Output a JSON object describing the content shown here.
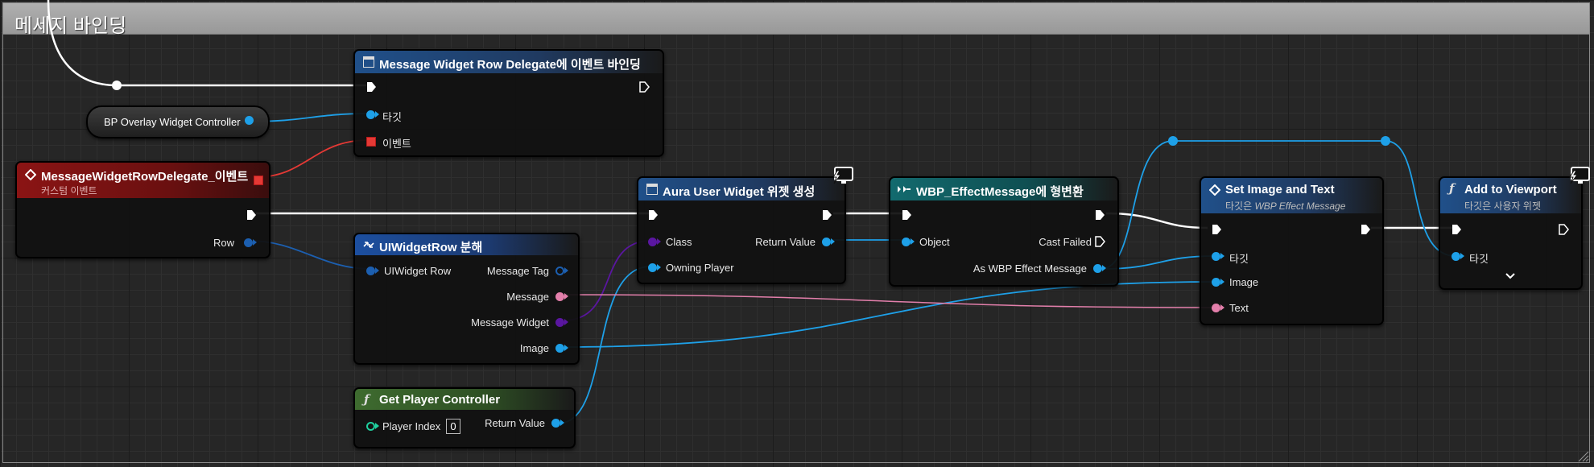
{
  "comment": {
    "title": "메세지 바인딩"
  },
  "colors": {
    "exec": "#ffffff",
    "object": "#1ea0e8",
    "class": "#5a16a0",
    "struct": "#1c5fb0",
    "string": "#e37fab",
    "text": "#e37fab",
    "event": "#e53935",
    "int": "#1fcf9e",
    "header_event": "#8b1414",
    "header_function": "#20508a",
    "header_pure": "#3e6b2f",
    "header_cast": "#126a6e"
  },
  "nodes": {
    "bind_event": {
      "title": "Message Widget Row Delegate에 이벤트 바인딩",
      "target_label": "타깃",
      "event_label": "이벤트",
      "icon": "function-square-icon"
    },
    "bp_overlay": {
      "label": "BP Overlay Widget Controller"
    },
    "custom_event": {
      "title": "MessageWidgetRowDelegate_이벤트",
      "subtitle": "커스텀 이벤트",
      "row_label": "Row",
      "icon": "event-diamond-icon"
    },
    "break_row": {
      "title": "UIWidgetRow 분해",
      "in_label": "UIWidget Row",
      "out_tag": "Message Tag",
      "out_message": "Message",
      "out_widget": "Message Widget",
      "out_image": "Image",
      "icon": "struct-break-icon"
    },
    "get_pc": {
      "title": "Get Player Controller",
      "player_index_label": "Player Index",
      "player_index_value": "0",
      "return_label": "Return Value",
      "icon": "function-f-icon"
    },
    "create_widget": {
      "title": "Aura User Widget 위젯 생성",
      "class_label": "Class",
      "owning_label": "Owning Player",
      "return_label": "Return Value",
      "icon": "function-square-icon",
      "badge": "monitor-lightning-icon"
    },
    "cast": {
      "title": "WBP_EffectMessage에 형변환",
      "object_label": "Object",
      "cast_failed_label": "Cast Failed",
      "as_label": "As WBP Effect Message",
      "icon": "cast-arrows-icon"
    },
    "set_image_text": {
      "title": "Set Image and Text",
      "subtitle_prefix": "타깃은 ",
      "subtitle_target": "WBP Effect Message",
      "target_label": "타깃",
      "image_label": "Image",
      "text_label": "Text",
      "icon": "event-diamond-icon"
    },
    "add_viewport": {
      "title": "Add to Viewport",
      "subtitle": "타깃은 사용자 위젯",
      "target_label": "타깃",
      "icon": "function-f-icon",
      "badge": "monitor-lightning-icon"
    }
  }
}
